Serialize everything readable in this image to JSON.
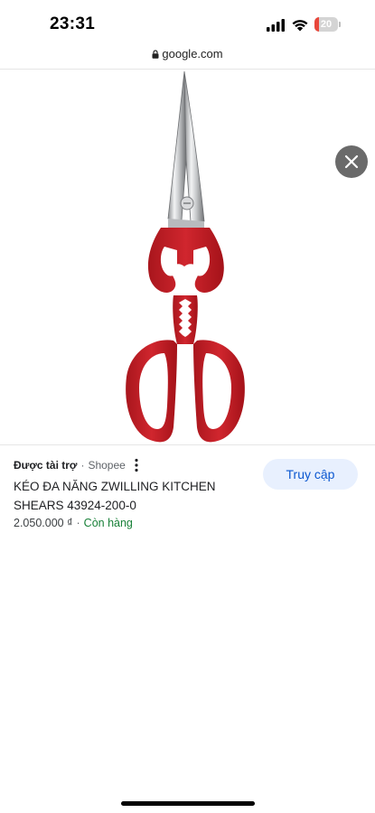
{
  "status_bar": {
    "time": "23:31",
    "battery_level": "20",
    "battery_fraction": 0.2,
    "icons": [
      "signal-icon",
      "wifi-icon",
      "battery-icon"
    ]
  },
  "url_bar": {
    "domain": "google.com",
    "icon": "lock-icon"
  },
  "image_viewer": {
    "close_icon": "close-icon",
    "product_image": "red-kitchen-shears"
  },
  "product": {
    "sponsored_label": "Được tài trợ",
    "separator": "·",
    "store": "Shopee",
    "more_icon": "more-vert-icon",
    "title": "KÉO ĐA NĂNG ZWILLING KITCHEN SHEARS 43924-200-0",
    "price": "2.050.000 ₫",
    "availability": "Còn hàng",
    "visit_button_label": "Truy cập"
  },
  "colors": {
    "accent_blue": "#0b57d0",
    "button_bg": "#e8f0fe",
    "in_stock_green": "#188038",
    "handle_red": "#c8222a",
    "battery_red": "#e8473b"
  }
}
